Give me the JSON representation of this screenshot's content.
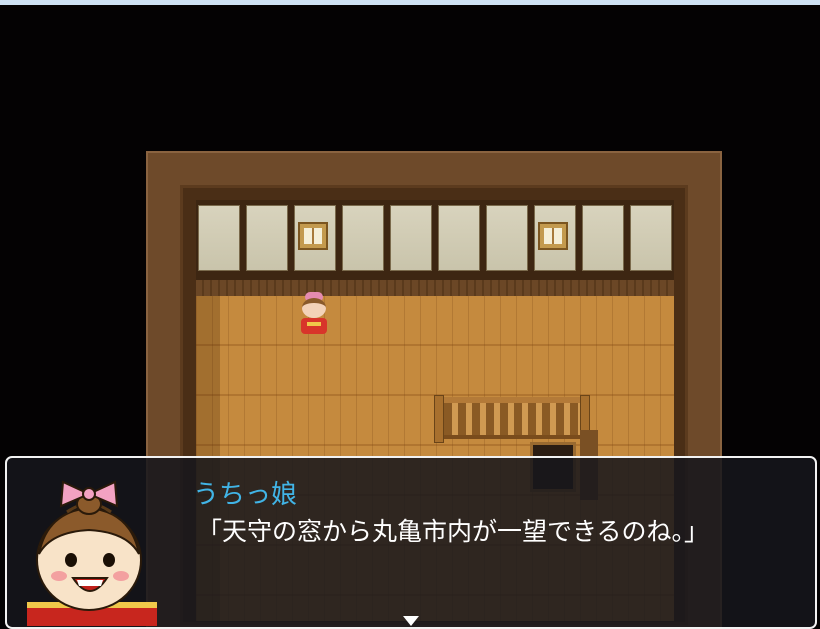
{
  "message": {
    "speaker": "うちっ娘",
    "text": "「天守の窓から丸亀市内が一望できるのね。」"
  },
  "icons": {
    "face": "character-portrait",
    "sprite": "player-sprite",
    "pause": "continue-arrow-icon"
  },
  "colors": {
    "speaker": "#41b4e6",
    "text": "#ffffff",
    "window_bg": "#16161c",
    "window_border": "#f2f2f2"
  }
}
